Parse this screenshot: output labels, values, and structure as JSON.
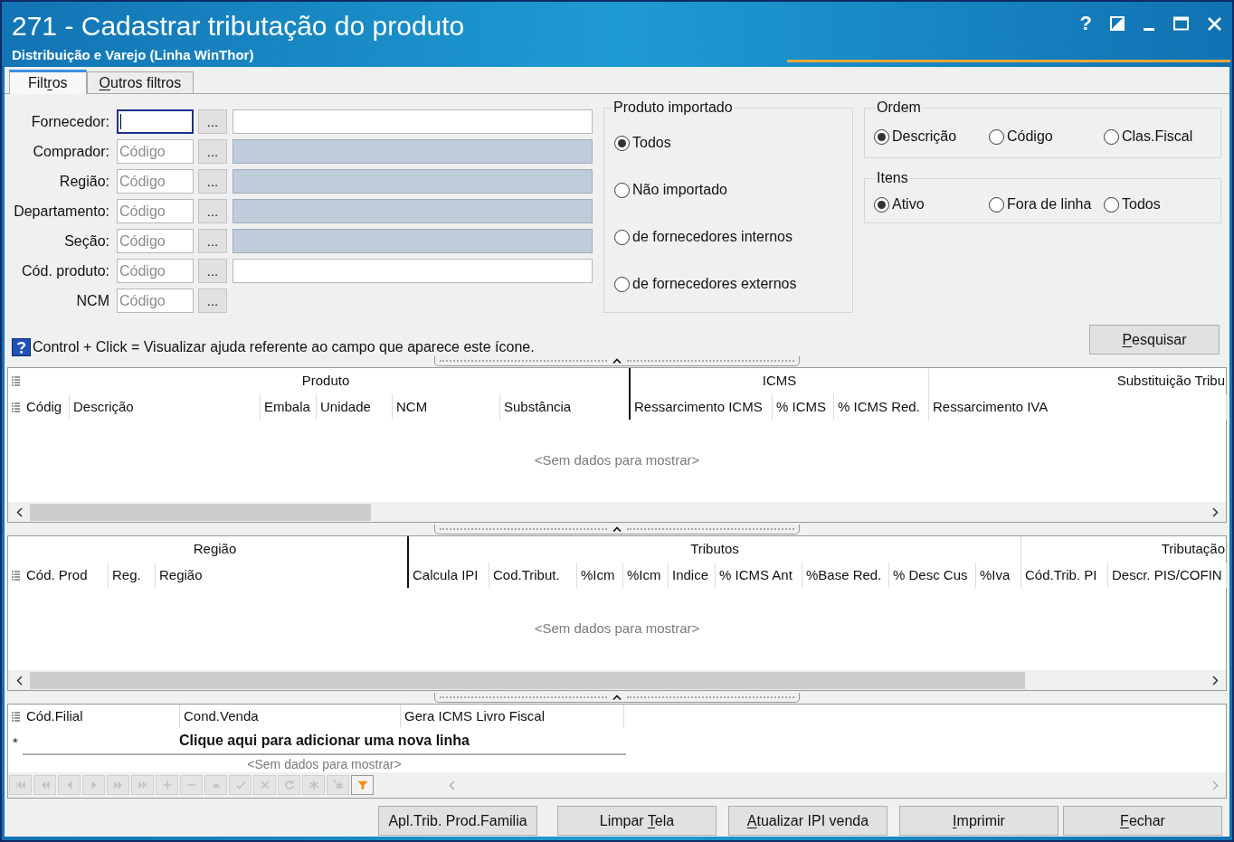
{
  "window": {
    "title": "271 - Cadastrar tributação do produto",
    "subtitle": "Distribuição e Varejo (Linha WinThor)",
    "help_button": "?"
  },
  "tabs": [
    {
      "before": "Filt",
      "access_key": "r",
      "after": "os",
      "selected": true
    },
    {
      "access_key": "O",
      "after": "utros filtros",
      "selected": false
    }
  ],
  "filters": {
    "fields": [
      {
        "label": "Fornecedor:",
        "focused": true,
        "lookup_button": "...",
        "description": {
          "disabled": false
        }
      },
      {
        "label": "Comprador:",
        "placeholder": "Código",
        "focused": false,
        "lookup_button": "...",
        "description": {
          "disabled": true
        }
      },
      {
        "label": "Região:",
        "placeholder": "Código",
        "focused": false,
        "lookup_button": "...",
        "description": {
          "disabled": true
        }
      },
      {
        "label": "Departamento:",
        "placeholder": "Código",
        "focused": false,
        "lookup_button": "...",
        "description": {
          "disabled": true
        }
      },
      {
        "label": "Seção:",
        "placeholder": "Código",
        "focused": false,
        "lookup_button": "...",
        "description": {
          "disabled": true
        }
      },
      {
        "label": "Cód. produto:",
        "placeholder": "Código",
        "focused": false,
        "lookup_button": "...",
        "description": {
          "disabled": false
        }
      },
      {
        "label": "NCM",
        "placeholder": "Código",
        "focused": false,
        "lookup_button": "..."
      }
    ],
    "help_note": "Control + Click = Visualizar ajuda referente ao campo que aparece este ícone."
  },
  "produto_importado": {
    "title": "Produto importado",
    "options": [
      {
        "label": "Todos",
        "selected": true
      },
      {
        "label": "Não importado",
        "selected": false
      },
      {
        "label": "de fornecedores internos",
        "selected": false
      },
      {
        "label": "de fornecedores externos",
        "selected": false
      }
    ]
  },
  "ordem": {
    "title": "Ordem",
    "options": [
      {
        "label": "Descrição",
        "selected": true
      },
      {
        "label": "Código",
        "selected": false
      },
      {
        "label": "Clas.Fiscal",
        "selected": false
      }
    ]
  },
  "itens": {
    "title": "Itens",
    "options": [
      {
        "label": "Ativo",
        "selected": true
      },
      {
        "label": "Fora de linha",
        "selected": false
      },
      {
        "label": "Todos",
        "selected": false
      }
    ]
  },
  "search_button": {
    "access_key": "P",
    "after": "esquisar"
  },
  "grids": [
    {
      "band_row_button": true,
      "bands": [
        {
          "label": "Produto",
          "fixed": true,
          "columns": [
            "Códig",
            "Descrição",
            "Embala",
            "Unidade",
            "NCM",
            "Substância"
          ]
        },
        {
          "label": "ICMS",
          "fixed": false,
          "columns": [
            "Ressarcimento ICMS",
            "% ICMS",
            "% ICMS Red."
          ]
        },
        {
          "label": "Substituição Tribu",
          "fixed": false,
          "columns": [
            "Ressarcimento IVA"
          ]
        }
      ],
      "empty_text": "<Sem dados para mostrar>"
    },
    {
      "band_row_button": false,
      "bands": [
        {
          "label": "Região",
          "fixed": true,
          "columns": [
            "Cód. Prod",
            "Reg.",
            "Região"
          ]
        },
        {
          "label": "Tributos",
          "fixed": false,
          "columns": [
            "Calcula IPI",
            "Cod.Tribut.",
            "%Icm",
            "%Icm",
            "Indice",
            "% ICMS Ant",
            "%Base Red.",
            "% Desc Cus",
            "%Iva"
          ]
        },
        {
          "label": "Tributação",
          "fixed": false,
          "columns": [
            "Cód.Trib. PI",
            "Descr. PIS/COFIN"
          ]
        }
      ],
      "empty_text": "<Sem dados para mostrar>"
    }
  ],
  "detail_grid": {
    "columns": [
      "Cód.Filial",
      "Cond.Venda",
      "Gera ICMS Livro Fiscal"
    ],
    "new_row_marker": "*",
    "new_row_text": "Clique aqui para adicionar uma nova linha",
    "empty_text": "<Sem dados para mostrar>",
    "navigator": [
      {
        "kind": "first",
        "disabled": true
      },
      {
        "kind": "prior_page",
        "disabled": true
      },
      {
        "kind": "prior",
        "disabled": true
      },
      {
        "kind": "next",
        "disabled": true
      },
      {
        "kind": "next_page",
        "disabled": true
      },
      {
        "kind": "last",
        "disabled": true
      },
      {
        "kind": "insert",
        "disabled": true
      },
      {
        "kind": "delete",
        "disabled": true
      },
      {
        "kind": "edit",
        "disabled": true
      },
      {
        "kind": "post",
        "disabled": true
      },
      {
        "kind": "cancel",
        "disabled": true
      },
      {
        "kind": "refresh",
        "disabled": true
      },
      {
        "kind": "set_bookmark",
        "disabled": true
      },
      {
        "kind": "goto_bookmark",
        "disabled": true
      },
      {
        "kind": "filter",
        "disabled": false
      }
    ]
  },
  "buttons": [
    {
      "before": "Apl.Trib. Prod.Familia"
    },
    {
      "before": "Limpar ",
      "access_key": "T",
      "after": "ela"
    },
    {
      "access_key": "A",
      "after": "tualizar IPI venda"
    },
    {
      "access_key": "I",
      "after": "mprimir"
    },
    {
      "access_key": "F",
      "after": "echar"
    }
  ]
}
